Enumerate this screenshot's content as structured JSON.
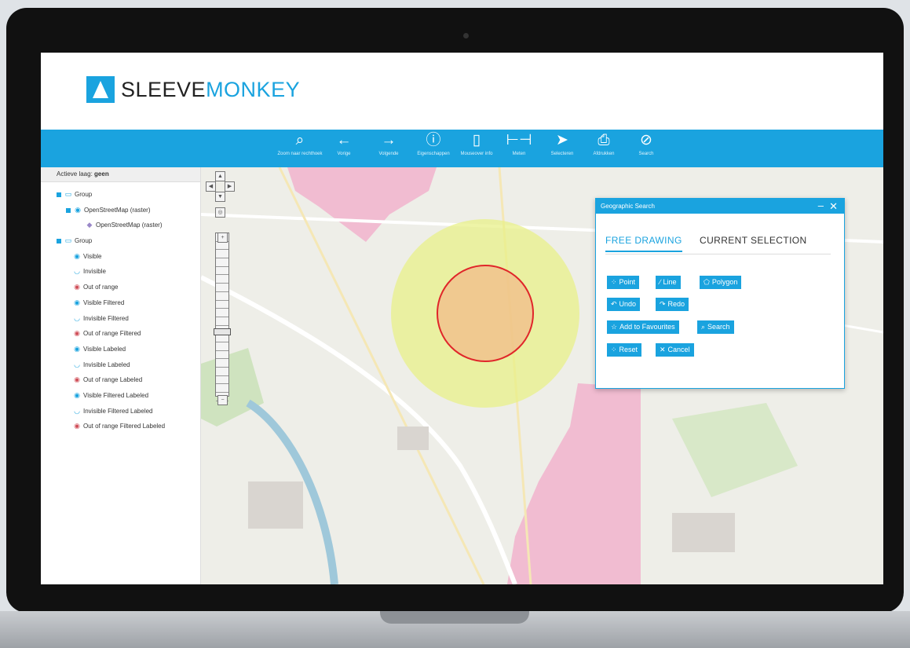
{
  "brand": {
    "part1": "SLEEVE",
    "part2": "MONKEY"
  },
  "toolbar": {
    "items": [
      {
        "label": "Zoom naar rechthoek",
        "icon": "magnifier-icon"
      },
      {
        "label": "Vorige",
        "icon": "arrow-left-icon"
      },
      {
        "label": "Volgende",
        "icon": "arrow-right-icon"
      },
      {
        "label": "Eigenschappen",
        "icon": "info-icon"
      },
      {
        "label": "Mouseover info",
        "icon": "mouse-icon"
      },
      {
        "label": "Meten",
        "icon": "ruler-icon"
      },
      {
        "label": "Selecteren",
        "icon": "cursor-icon"
      },
      {
        "label": "Afdrukken",
        "icon": "printer-icon"
      },
      {
        "label": "Search",
        "icon": "compass-icon"
      }
    ]
  },
  "sidebar": {
    "active_prefix": "Actieve laag:",
    "active_value": "geen",
    "tree": [
      {
        "label": "Group",
        "icon": "folder-icon"
      },
      {
        "label": "OpenStreetMap (raster)",
        "icon": "eye-icon"
      },
      {
        "label": "OpenStreetMap (raster)",
        "icon": "layer-icon"
      },
      {
        "label": "Group",
        "icon": "folder-icon"
      },
      {
        "label": "Visible",
        "icon": "eye-icon"
      },
      {
        "label": "Invisible",
        "icon": "eye-closed-icon"
      },
      {
        "label": "Out of range",
        "icon": "out-of-range-icon"
      },
      {
        "label": "Visible Filtered",
        "icon": "eye-filter-icon"
      },
      {
        "label": "Invisible Filtered",
        "icon": "eye-closed-filter-icon"
      },
      {
        "label": "Out of range Filtered",
        "icon": "out-of-range-filter-icon"
      },
      {
        "label": "Visible Labeled",
        "icon": "eye-label-icon"
      },
      {
        "label": "Invisible Labeled",
        "icon": "eye-closed-label-icon"
      },
      {
        "label": "Out of range Labeled",
        "icon": "out-of-range-label-icon"
      },
      {
        "label": "Visible Filtered Labeled",
        "icon": "eye-filter-label-icon"
      },
      {
        "label": "Invisible Filtered Labeled",
        "icon": "eye-closed-filter-label-icon"
      },
      {
        "label": "Out of range Filtered Labeled",
        "icon": "out-of-range-filter-label-icon"
      }
    ]
  },
  "panel": {
    "title": "Geographic Search",
    "tabs": [
      {
        "label": "FREE DRAWING",
        "active": true
      },
      {
        "label": "CURRENT SELECTION",
        "active": false
      }
    ],
    "buttons": {
      "point": "Point",
      "line": "Line",
      "polygon": "Polygon",
      "undo": "Undo",
      "redo": "Redo",
      "favourites": "Add to Favourites",
      "search": "Search",
      "reset": "Reset",
      "cancel": "Cancel"
    }
  },
  "colors": {
    "accent": "#1aa3df",
    "buffer_fill": "#e8f08a",
    "circle_stroke": "#e0262a",
    "area_pink": "#f2a7c8"
  }
}
